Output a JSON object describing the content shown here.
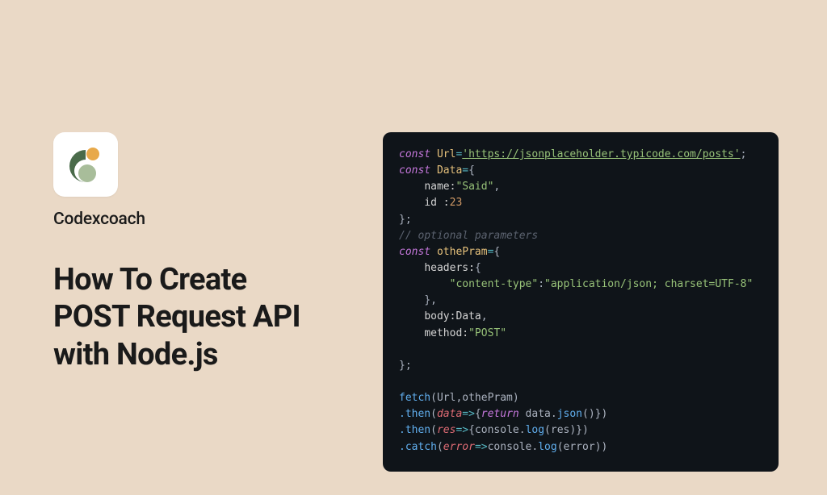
{
  "brand": {
    "name": "Codexcoach"
  },
  "headline": {
    "line1": "How To Create",
    "line2": "POST Request API",
    "line3": "with Node.js"
  },
  "code": {
    "kw_const1": "const",
    "id_url": "Url",
    "eq": "=",
    "url_val": "'https://jsonplaceholder.typicode.com/posts'",
    "semi": ";",
    "kw_const2": "const",
    "id_data": "Data",
    "brace_open": "{",
    "name_key": "name:",
    "name_val": "\"Said\"",
    "comma": ",",
    "id_key": "id :",
    "id_val": "23",
    "brace_close": "};",
    "comment": "// optional parameters",
    "kw_const3": "const",
    "id_othe": "othePram",
    "headers_key": "headers:",
    "ct_key": "\"content-type\"",
    "ct_colon": ":",
    "ct_val": "\"application/json; charset=UTF-8\"",
    "brace_close2": "},",
    "body_key": "body:",
    "body_val": "Data",
    "method_key": "method:",
    "method_val": "\"POST\"",
    "fetch": "fetch",
    "fetch_args_open": "(Url,othePram)",
    "then1": ".then",
    "then1_param": "data",
    "arrow": "=>",
    "then1_body_open": "{",
    "return_kw": "return",
    "then1_call": " data.",
    "json_fn": "json",
    "then1_call_end": "()})",
    "then2": ".then",
    "then2_param": "res",
    "then2_body": "{console.",
    "log_fn": "log",
    "then2_end": "(res)})",
    "catch": ".catch",
    "catch_param": "error",
    "catch_body": "console.",
    "catch_end": "(error))"
  }
}
